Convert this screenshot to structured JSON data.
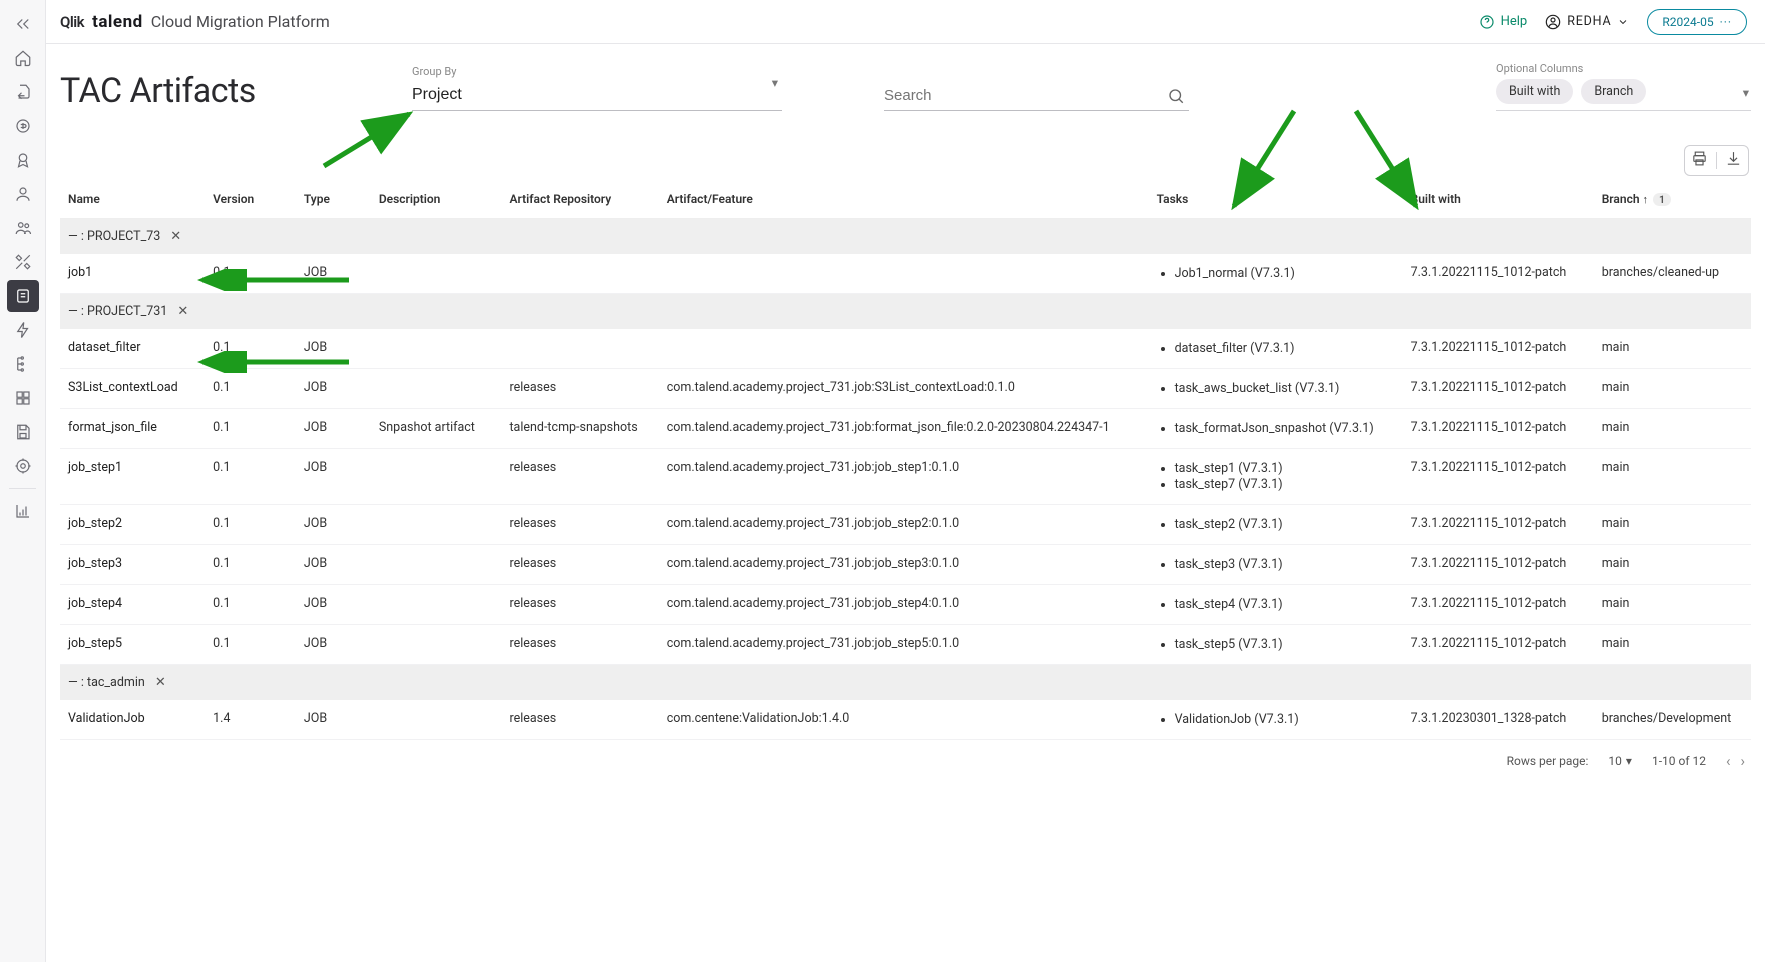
{
  "topbar": {
    "brand_qlik": "Qlik",
    "brand_talend": "talend",
    "platform": "Cloud Migration Platform",
    "help": "Help",
    "user": "REDHA",
    "version": "R2024-05"
  },
  "page": {
    "title": "TAC Artifacts",
    "group_by_label": "Group By",
    "group_by_value": "Project",
    "search_placeholder": "Search",
    "optional_columns_label": "Optional Columns",
    "chip_built": "Built with",
    "chip_branch": "Branch"
  },
  "columns": {
    "name": "Name",
    "version": "Version",
    "type": "Type",
    "description": "Description",
    "repo": "Artifact Repository",
    "feature": "Artifact/Feature",
    "tasks": "Tasks",
    "built": "Built with",
    "branch": "Branch",
    "branch_sort_badge": "1"
  },
  "groups": [
    {
      "label": "— : PROJECT_73",
      "rows": [
        {
          "name": "job1",
          "version": "0.1",
          "type": "JOB",
          "desc": "",
          "repo": "",
          "feature": "",
          "tasks": [
            "Job1_normal (V7.3.1)"
          ],
          "built": "7.3.1.20221115_1012-patch",
          "branch": "branches/cleaned-up"
        }
      ]
    },
    {
      "label": "— : PROJECT_731",
      "rows": [
        {
          "name": "dataset_filter",
          "version": "0.1",
          "type": "JOB",
          "desc": "",
          "repo": "",
          "feature": "",
          "tasks": [
            "dataset_filter (V7.3.1)"
          ],
          "built": "7.3.1.20221115_1012-patch",
          "branch": "main"
        },
        {
          "name": "S3List_contextLoad",
          "version": "0.1",
          "type": "JOB",
          "desc": "",
          "repo": "releases",
          "feature": "com.talend.academy.project_731.job:S3List_contextLoad:0.1.0",
          "tasks": [
            "task_aws_bucket_list (V7.3.1)"
          ],
          "built": "7.3.1.20221115_1012-patch",
          "branch": "main"
        },
        {
          "name": "format_json_file",
          "version": "0.1",
          "type": "JOB",
          "desc": "Snpashot artifact",
          "repo": "talend-tcmp-snapshots",
          "feature": "com.talend.academy.project_731.job:format_json_file:0.2.0-20230804.224347-1",
          "tasks": [
            "task_formatJson_snpashot (V7.3.1)"
          ],
          "built": "7.3.1.20221115_1012-patch",
          "branch": "main"
        },
        {
          "name": "job_step1",
          "version": "0.1",
          "type": "JOB",
          "desc": "",
          "repo": "releases",
          "feature": "com.talend.academy.project_731.job:job_step1:0.1.0",
          "tasks": [
            "task_step1 (V7.3.1)",
            "task_step7 (V7.3.1)"
          ],
          "built": "7.3.1.20221115_1012-patch",
          "branch": "main"
        },
        {
          "name": "job_step2",
          "version": "0.1",
          "type": "JOB",
          "desc": "",
          "repo": "releases",
          "feature": "com.talend.academy.project_731.job:job_step2:0.1.0",
          "tasks": [
            "task_step2 (V7.3.1)"
          ],
          "built": "7.3.1.20221115_1012-patch",
          "branch": "main"
        },
        {
          "name": "job_step3",
          "version": "0.1",
          "type": "JOB",
          "desc": "",
          "repo": "releases",
          "feature": "com.talend.academy.project_731.job:job_step3:0.1.0",
          "tasks": [
            "task_step3 (V7.3.1)"
          ],
          "built": "7.3.1.20221115_1012-patch",
          "branch": "main"
        },
        {
          "name": "job_step4",
          "version": "0.1",
          "type": "JOB",
          "desc": "",
          "repo": "releases",
          "feature": "com.talend.academy.project_731.job:job_step4:0.1.0",
          "tasks": [
            "task_step4 (V7.3.1)"
          ],
          "built": "7.3.1.20221115_1012-patch",
          "branch": "main"
        },
        {
          "name": "job_step5",
          "version": "0.1",
          "type": "JOB",
          "desc": "",
          "repo": "releases",
          "feature": "com.talend.academy.project_731.job:job_step5:0.1.0",
          "tasks": [
            "task_step5 (V7.3.1)"
          ],
          "built": "7.3.1.20221115_1012-patch",
          "branch": "main"
        }
      ]
    },
    {
      "label": "— : tac_admin",
      "rows": [
        {
          "name": "ValidationJob",
          "version": "1.4",
          "type": "JOB",
          "desc": "",
          "repo": "releases",
          "feature": "com.centene:ValidationJob:1.4.0",
          "tasks": [
            "ValidationJob (V7.3.1)"
          ],
          "built": "7.3.1.20230301_1328-patch",
          "branch": "branches/Development"
        }
      ]
    }
  ],
  "pager": {
    "rows_label": "Rows per page:",
    "rows_value": "10",
    "range": "1-10 of 12"
  }
}
